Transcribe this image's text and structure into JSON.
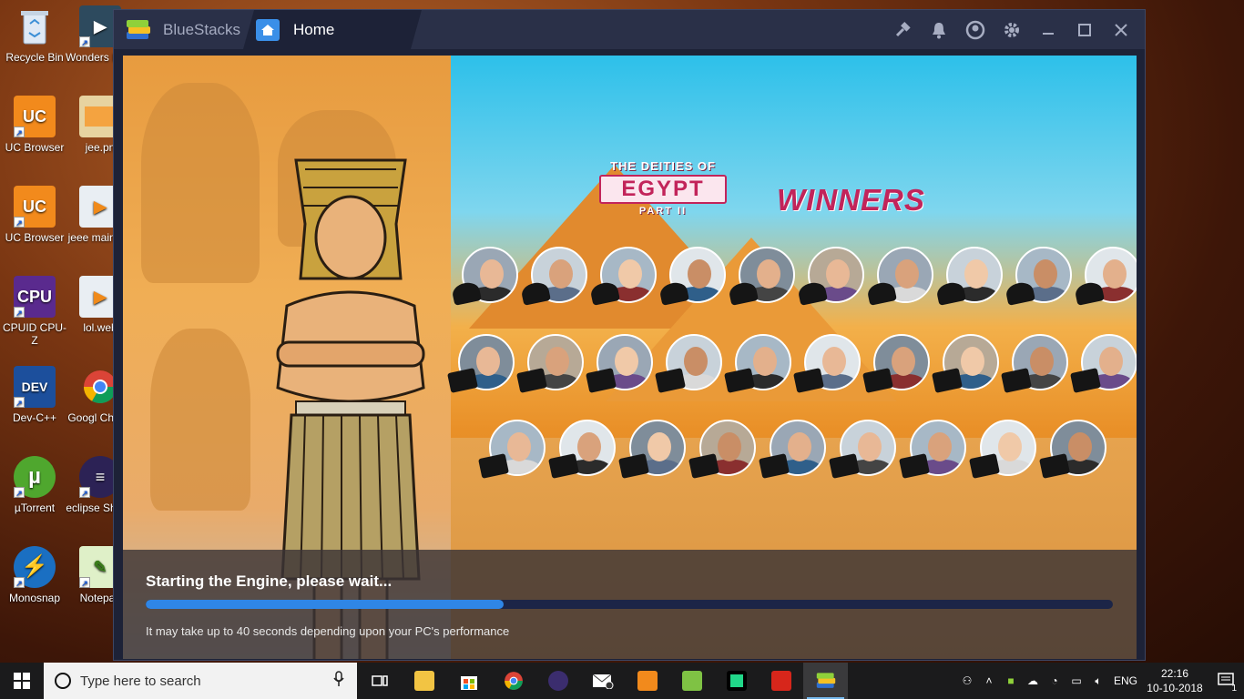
{
  "desktop_icons": [
    {
      "label": "Recycle Bin",
      "icon": "recycle-bin-icon"
    },
    {
      "label": "Wonders Filmor",
      "icon": "filmora-icon"
    },
    {
      "label": "UC Browser",
      "icon": "uc-browser-icon"
    },
    {
      "label": "jee.pn",
      "icon": "image-file-icon"
    },
    {
      "label": "UC Browser",
      "icon": "uc-browser-icon"
    },
    {
      "label": "jeee main.we",
      "icon": "media-file-icon"
    },
    {
      "label": "CPUID CPU-Z",
      "icon": "cpuz-icon"
    },
    {
      "label": "lol.web",
      "icon": "media-file-icon"
    },
    {
      "label": "Dev-C++",
      "icon": "devcpp-icon"
    },
    {
      "label": "Googl Chrom",
      "icon": "chrome-icon"
    },
    {
      "label": "µTorrent",
      "icon": "utorrent-icon"
    },
    {
      "label": "eclipse Shortc",
      "icon": "eclipse-icon"
    },
    {
      "label": "Monosnap",
      "icon": "monosnap-icon"
    },
    {
      "label": "Notepac",
      "icon": "notepad-icon"
    }
  ],
  "window": {
    "app_tab_label": "BlueStacks",
    "home_tab_label": "Home",
    "toolbar_icons": [
      "hammer-icon",
      "bell-icon",
      "account-icon",
      "gear-icon",
      "minimize-icon",
      "maximize-icon",
      "close-icon"
    ]
  },
  "banner": {
    "title_line1": "THE DEITIES OF",
    "title_line2": "EGYPT",
    "title_line3": "PART II",
    "winners_label": "WINNERS"
  },
  "loading": {
    "title": "Starting the Engine, please wait...",
    "progress_percent": 37,
    "subtitle": "It may take up to 40 seconds depending upon your PC's performance"
  },
  "taskbar": {
    "search_placeholder": "Type here to search",
    "apps": [
      "task-view-icon",
      "file-explorer-icon",
      "store-icon",
      "chrome-icon",
      "eclipse-icon",
      "mail-icon",
      "uc-browser-icon",
      "notepad-icon",
      "pycharm-icon",
      "acrobat-icon",
      "bluestacks-icon"
    ],
    "language": "ENG",
    "time": "22:16",
    "date": "10-10-2018",
    "notification_count": "1"
  },
  "colors": {
    "window_bg": "#1d2237",
    "titlebar_bg": "#2a3048",
    "progress_fill": "#2f86e6",
    "accent_pink": "#c2245a"
  }
}
